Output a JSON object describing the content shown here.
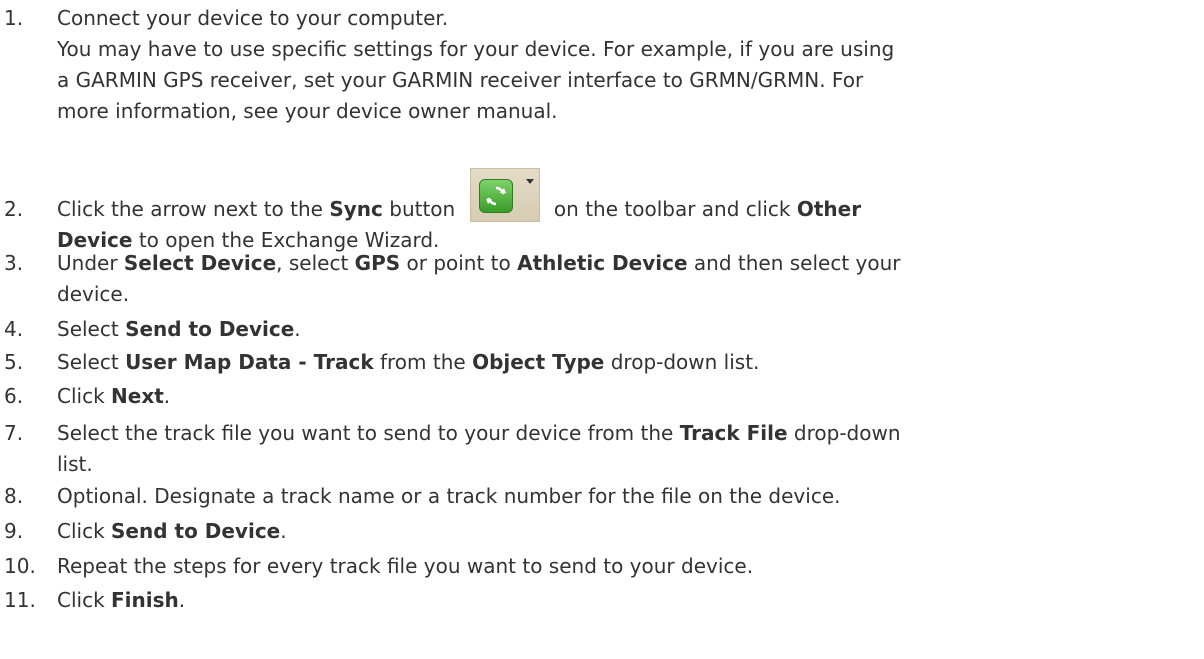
{
  "steps": [
    {
      "num": "1.",
      "lines": [
        [
          {
            "t": "Connect your device to your computer."
          }
        ],
        [
          {
            "t": "You may have to use specific settings for your device. For example, if you are using"
          }
        ],
        [
          {
            "t": "a GARMIN GPS receiver, set your GARMIN receiver interface to GRMN/GRMN. For"
          }
        ],
        [
          {
            "t": "more information, see your device owner manual."
          }
        ]
      ]
    },
    {
      "num": "2.",
      "lines": [
        [
          {
            "t": "Click the arrow next to the "
          },
          {
            "t": "Sync",
            "b": true
          },
          {
            "t": " button "
          },
          {
            "icon": "sync-button"
          },
          {
            "t": " on the toolbar and click "
          },
          {
            "t": "Other",
            "b": true
          }
        ],
        [
          {
            "t": "Device",
            "b": true
          },
          {
            "t": " to open the Exchange Wizard."
          }
        ]
      ]
    },
    {
      "num": "3.",
      "lines": [
        [
          {
            "t": "Under "
          },
          {
            "t": "Select Device",
            "b": true
          },
          {
            "t": ", select "
          },
          {
            "t": "GPS",
            "b": true
          },
          {
            "t": " or point to "
          },
          {
            "t": "Athletic Device",
            "b": true
          },
          {
            "t": " and then select your"
          }
        ],
        [
          {
            "t": "device."
          }
        ]
      ]
    },
    {
      "num": "4.",
      "lines": [
        [
          {
            "t": "Select "
          },
          {
            "t": "Send to Device",
            "b": true
          },
          {
            "t": "."
          }
        ]
      ]
    },
    {
      "num": "5.",
      "lines": [
        [
          {
            "t": "Select "
          },
          {
            "t": "User Map Data - Track",
            "b": true
          },
          {
            "t": " from the "
          },
          {
            "t": "Object Type",
            "b": true
          },
          {
            "t": " drop-down list."
          }
        ]
      ]
    },
    {
      "num": "6.",
      "lines": [
        [
          {
            "t": "Click "
          },
          {
            "t": "Next",
            "b": true
          },
          {
            "t": "."
          }
        ]
      ]
    },
    {
      "num": "7.",
      "lines": [
        [
          {
            "t": "Select the track file you want to send to your device from the "
          },
          {
            "t": "Track File",
            "b": true
          },
          {
            "t": " drop-down"
          }
        ],
        [
          {
            "t": "list."
          }
        ]
      ]
    },
    {
      "num": "8.",
      "lines": [
        [
          {
            "t": "Optional. Designate a track name or a track number for the file on the device."
          }
        ]
      ]
    },
    {
      "num": "9.",
      "lines": [
        [
          {
            "t": "Click "
          },
          {
            "t": "Send to Device",
            "b": true
          },
          {
            "t": "."
          }
        ]
      ]
    },
    {
      "num": "10.",
      "lines": [
        [
          {
            "t": "Repeat the steps for every track file you want to send to your device."
          }
        ]
      ]
    },
    {
      "num": "11.",
      "lines": [
        [
          {
            "t": "Click "
          },
          {
            "t": "Finish",
            "b": true
          },
          {
            "t": "."
          }
        ]
      ]
    }
  ]
}
